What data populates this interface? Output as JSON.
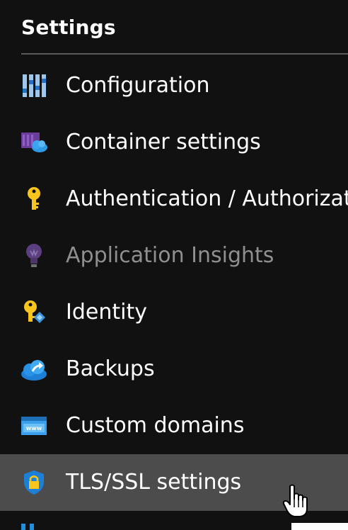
{
  "section": {
    "title": "Settings"
  },
  "menu": {
    "items": [
      {
        "label": "Configuration",
        "icon": "configuration-icon",
        "disabled": false,
        "selected": false
      },
      {
        "label": "Container settings",
        "icon": "container-cloud-icon",
        "disabled": false,
        "selected": false
      },
      {
        "label": "Authentication / Authorization",
        "icon": "key-icon",
        "disabled": false,
        "selected": false
      },
      {
        "label": "Application Insights",
        "icon": "lightbulb-icon",
        "disabled": true,
        "selected": false
      },
      {
        "label": "Identity",
        "icon": "identity-key-icon",
        "disabled": false,
        "selected": false
      },
      {
        "label": "Backups",
        "icon": "backup-cloud-icon",
        "disabled": false,
        "selected": false
      },
      {
        "label": "Custom domains",
        "icon": "www-icon",
        "disabled": false,
        "selected": false
      },
      {
        "label": "TLS/SSL settings",
        "icon": "shield-lock-icon",
        "disabled": false,
        "selected": true
      }
    ]
  },
  "colors": {
    "background": "#111111",
    "selected_row": "#4c4c4c",
    "divider": "#5a5a5a",
    "disabled_text": "#8f8f8f",
    "accent_blue": "#1e90e0",
    "key_yellow": "#f8c51c"
  }
}
